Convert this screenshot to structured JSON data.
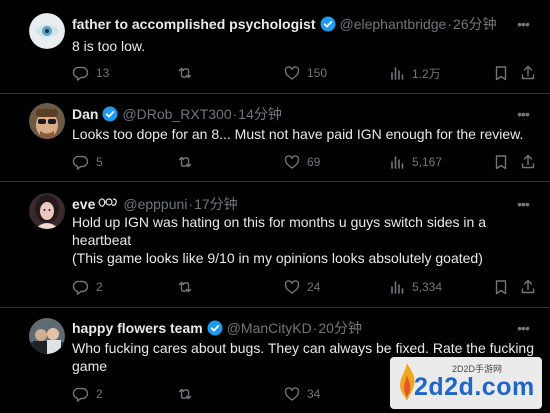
{
  "colors": {
    "background": "#000000",
    "text": "#e7e9ea",
    "muted": "#71767b",
    "verified": "#1d9bf0",
    "divider": "#2f3336"
  },
  "tweets": [
    {
      "name": "father to accomplished psychologist",
      "handle": "@elephantbridge",
      "dot": "·",
      "time": "26分钟",
      "text": [
        "8 is too low."
      ],
      "replies": "13",
      "reposts": "",
      "likes": "150",
      "views": "1.2万",
      "avatar_icon": "eye-avatar-icon"
    },
    {
      "name": "Dan",
      "handle": "@DRob_RXT300",
      "dot": "·",
      "time": "14分钟",
      "text": [
        "Looks too dope for an 8... Must not have paid IGN enough for the review."
      ],
      "replies": "5",
      "reposts": "",
      "likes": "69",
      "views": "5,167",
      "avatar_icon": "man-sunglasses-avatar-icon"
    },
    {
      "name": "eve",
      "handle": "@epppuni",
      "dot": "·",
      "time": "17分钟",
      "text": [
        "Hold up IGN was hating on this for months u guys switch sides in a",
        "heartbeat",
        "(This game looks like 9/10 in my opinions looks absolutely goated)"
      ],
      "replies": "2",
      "reposts": "",
      "likes": "24",
      "views": "5,334",
      "avatar_icon": "woman-avatar-icon"
    },
    {
      "name": "happy flowers team",
      "handle": "@ManCityKD",
      "dot": "·",
      "time": "20分钟",
      "text": [
        "Who fucking cares about bugs. They can always be fixed. Rate the fucking",
        "game"
      ],
      "replies": "2",
      "reposts": "",
      "likes": "34",
      "views": "",
      "avatar_icon": "group-photo-avatar-icon"
    }
  ],
  "watermark": {
    "small": "2D2D手游网",
    "big": "2d2d.com"
  }
}
